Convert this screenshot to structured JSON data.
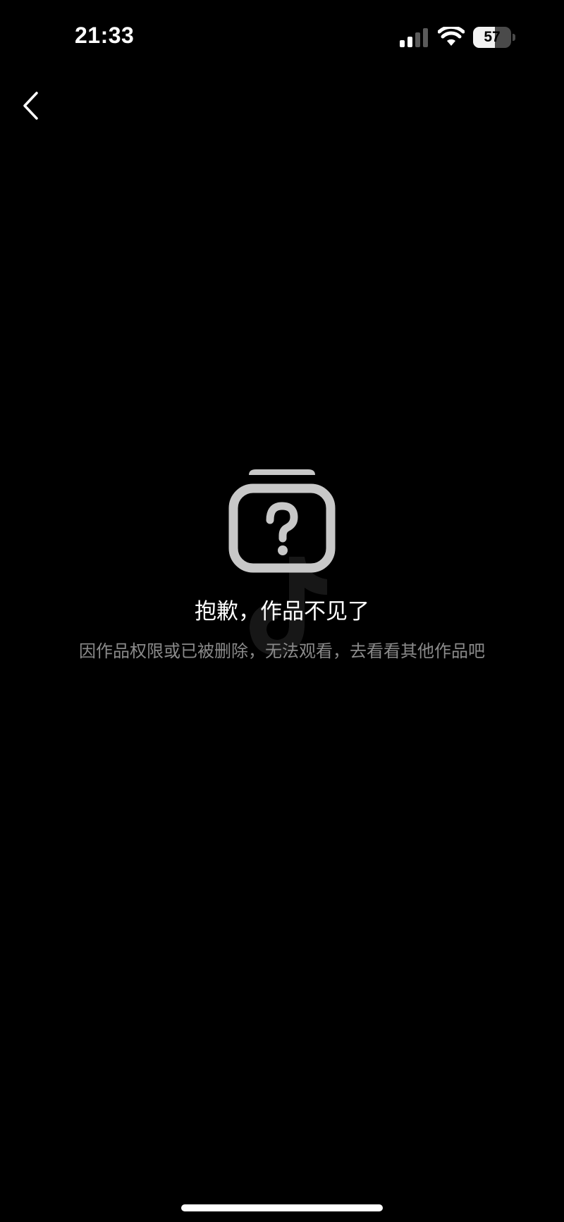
{
  "status_bar": {
    "time": "21:33",
    "battery_level": "57",
    "battery_fraction": 0.57,
    "icons": [
      "signal-icon",
      "wifi-icon",
      "battery-icon"
    ]
  },
  "nav": {
    "back_icon": "chevron-left-icon"
  },
  "empty_state": {
    "icon": "missing-video-icon",
    "title": "抱歉，作品不见了",
    "message": "因作品权限或已被删除，无法观看，去看看其他作品吧"
  },
  "colors": {
    "background": "#000000",
    "title": "#ffffff",
    "message": "#8a8a8a",
    "icon": "#c8c8c8"
  }
}
